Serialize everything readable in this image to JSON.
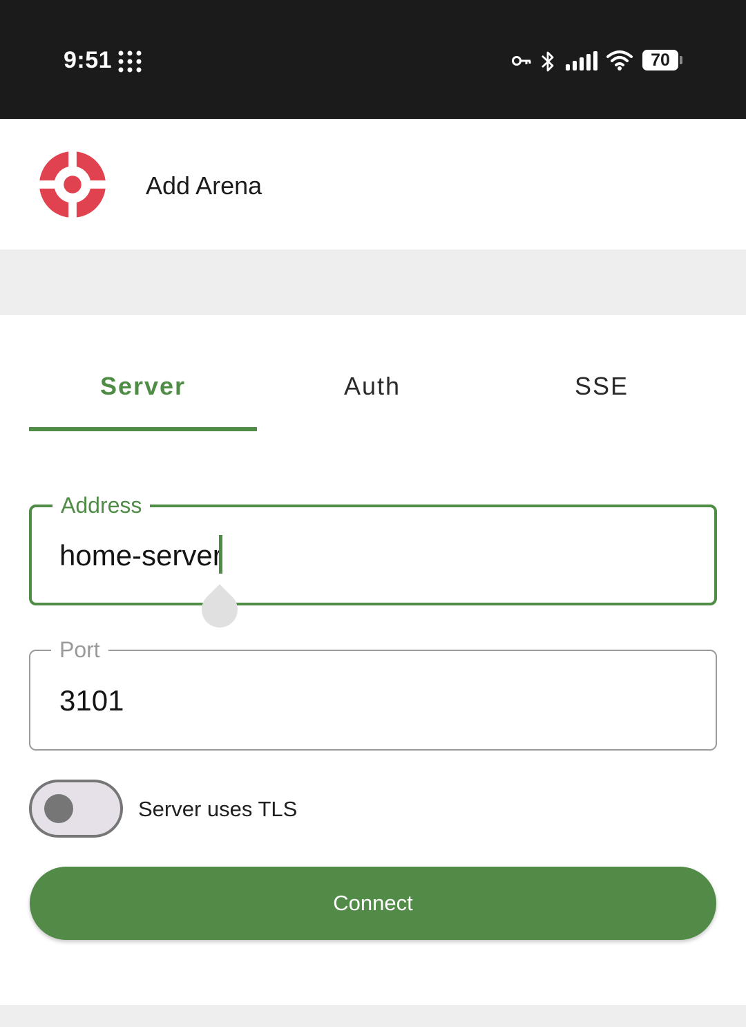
{
  "status_bar": {
    "time": "9:51",
    "battery_level": "70",
    "icons": [
      "dots-grid-icon",
      "vpn-key-icon",
      "bluetooth-icon",
      "cellular-signal-icon",
      "wifi-icon",
      "battery-icon"
    ]
  },
  "header": {
    "title": "Add Arena",
    "logo_icon": "target-logo-icon"
  },
  "tabs": [
    {
      "label": "Server",
      "active": true
    },
    {
      "label": "Auth",
      "active": false
    },
    {
      "label": "SSE",
      "active": false
    }
  ],
  "form": {
    "address": {
      "label": "Address",
      "value": "home-server"
    },
    "port": {
      "label": "Port",
      "value": "3101"
    },
    "tls_toggle": {
      "label": "Server uses TLS",
      "checked": false
    },
    "connect_label": "Connect"
  },
  "colors": {
    "accent": "#4f8c46",
    "logo_red": "#e0424f",
    "status_bar_bg": "#1b1b1b",
    "band_gray": "#eeeeee"
  }
}
